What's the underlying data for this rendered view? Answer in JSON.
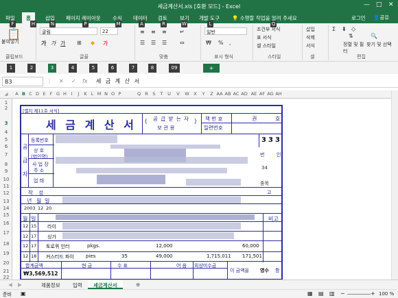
{
  "window": {
    "title": "세금계산서.xls [호환 모드] - Excel"
  },
  "tabs": [
    "파일",
    "홈",
    "삽입",
    "페이지 레이아웃",
    "수식",
    "데이터",
    "검토",
    "보기",
    "개발 도구"
  ],
  "tell_me": "수행할 작업을 알려 주세요",
  "account": {
    "login": "로그인",
    "share": "공유"
  },
  "keytips": [
    "F",
    "H",
    "N",
    "P",
    "M",
    "A",
    "R",
    "W",
    "L",
    "Q"
  ],
  "ribbon": {
    "clipboard": {
      "group": "클립보드",
      "paste": "붙여넣기"
    },
    "font": {
      "group": "글꼴",
      "name": "굴림",
      "size": "22"
    },
    "align": {
      "group": "맞춤"
    },
    "number": {
      "group": "표시 형식",
      "format": "일반"
    },
    "styles": {
      "group": "스타일",
      "items": [
        "조건부 서식",
        "표 서식",
        "셀 스타일"
      ]
    },
    "cells": {
      "group": "셀",
      "items": [
        "삽입",
        "삭제",
        "서식"
      ]
    },
    "edit": {
      "group": "편집",
      "items": [
        "정렬 및 필터",
        "찾기 및 선택"
      ]
    }
  },
  "qat_keys": [
    "1",
    "2",
    "3",
    "4",
    "5",
    "6",
    "7",
    "8",
    "09"
  ],
  "formula_bar": {
    "name_box": "B3",
    "formula": "세 금 계 산 서"
  },
  "columns": [
    "A",
    "B",
    "C",
    "D",
    "E",
    "F",
    "G",
    "H",
    "I",
    "J",
    "K",
    "L",
    "M",
    "N",
    "O",
    "P",
    "Q",
    "R",
    "S",
    "T",
    "U",
    "V",
    "W",
    "X",
    "Y",
    "Z",
    "AA",
    "AB",
    "AC",
    "AD",
    "AE",
    "AF",
    "AG",
    "AH"
  ],
  "rows": [
    "1",
    "2",
    "3",
    "4",
    "5",
    "6",
    "7",
    "8",
    "9",
    "10",
    "11",
    "12",
    "13",
    "14",
    "15",
    "16",
    "17",
    "18",
    "19",
    "20",
    "21",
    "22"
  ],
  "form": {
    "form_no": "[별지 제11호 서식]",
    "title": "세 금 계 산 서",
    "receiver_paren_open": "(",
    "receiver_line1": "공 급 받 는 자",
    "receiver_line2": "보   관   용",
    "receiver_paren_close": ")",
    "book_no": "책 번 호",
    "serial_no": "일련번호",
    "kwon": "권",
    "ho": "호",
    "digits": [
      "3",
      "3",
      "3"
    ],
    "supplier_side": [
      "공",
      "급",
      "자"
    ],
    "reg_no": "등록번호",
    "company": "상 호",
    "company_sub": "(법인명)",
    "business_place": "사 업 장",
    "address": "주 소",
    "business_type": "업 태",
    "write": "작 성",
    "year": "년",
    "month": "월",
    "day": "일",
    "date_vals": [
      "2003",
      "12",
      "20"
    ],
    "item_hdr_month": "월",
    "item_hdr_day": "일",
    "remark": "비고",
    "right_frag": [
      "번",
      "인",
      "34",
      "5",
      "종목",
      "고"
    ],
    "rows": [
      {
        "m": "12",
        "d": "15",
        "name": "라이"
      },
      {
        "m": "12",
        "d": "17",
        "name": "싱가"
      },
      {
        "m": "12",
        "d": "17",
        "name": "토로퀴 인터",
        "unit": "pkgs.",
        "qty": "",
        "price": "12,000",
        "amount": "",
        "tax": "60,000"
      },
      {
        "m": "12",
        "d": "18",
        "name": "커스터드 파이",
        "unit": "pies",
        "qty": "35",
        "price": "49,000",
        "amount": "1,715,011",
        "tax": "171,501"
      }
    ],
    "total_label": "합계금액",
    "total": "₩3,569,512",
    "cash": "현 금",
    "check": "수 표",
    "note": "어 음",
    "credit": "외상미수금",
    "this_amount": "이 금액을",
    "receipt": "영수",
    "claim": "함"
  },
  "sheets": [
    "제품정보",
    "입력",
    "세금계산서"
  ],
  "status": {
    "mode": "준비",
    "zoom": "100 %"
  }
}
